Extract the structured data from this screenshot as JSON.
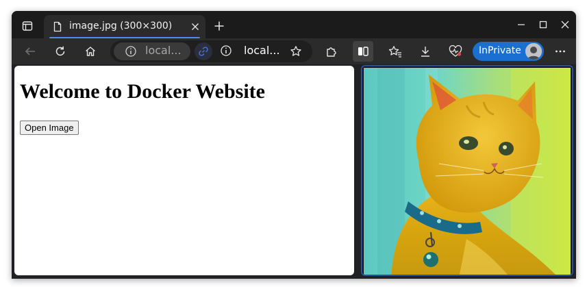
{
  "window": {
    "tab_title": "image.jpg (300×300)"
  },
  "toolbar": {
    "address_primary": "local...",
    "address_secondary": "local...",
    "inprivate_label": "InPrivate"
  },
  "page": {
    "heading": "Welcome to Docker Website",
    "open_button_label": "Open Image"
  },
  "icons": {
    "tab_actions": "tab-actions-icon",
    "tab_file": "file-icon",
    "tab_close": "close-icon",
    "new_tab": "plus-icon",
    "minimize": "minimize-icon",
    "maximize": "maximize-icon",
    "close_window": "close-icon",
    "back": "back-arrow-icon",
    "refresh": "refresh-icon",
    "home": "home-icon",
    "info": "info-icon",
    "link": "link-icon",
    "favorite": "star-icon",
    "extensions": "puzzle-icon",
    "split_screen": "split-screen-icon",
    "favorites": "favorites-icon",
    "downloads": "download-icon",
    "browser_essentials": "heart-pulse-icon",
    "avatar": "avatar",
    "more": "more-icon"
  },
  "colors": {
    "accent": "#4c8cf5",
    "inprivate_bg": "#1a6fd1",
    "toolbar_bg": "#2b2b2b",
    "titlebar_bg": "#1b1b1c"
  }
}
